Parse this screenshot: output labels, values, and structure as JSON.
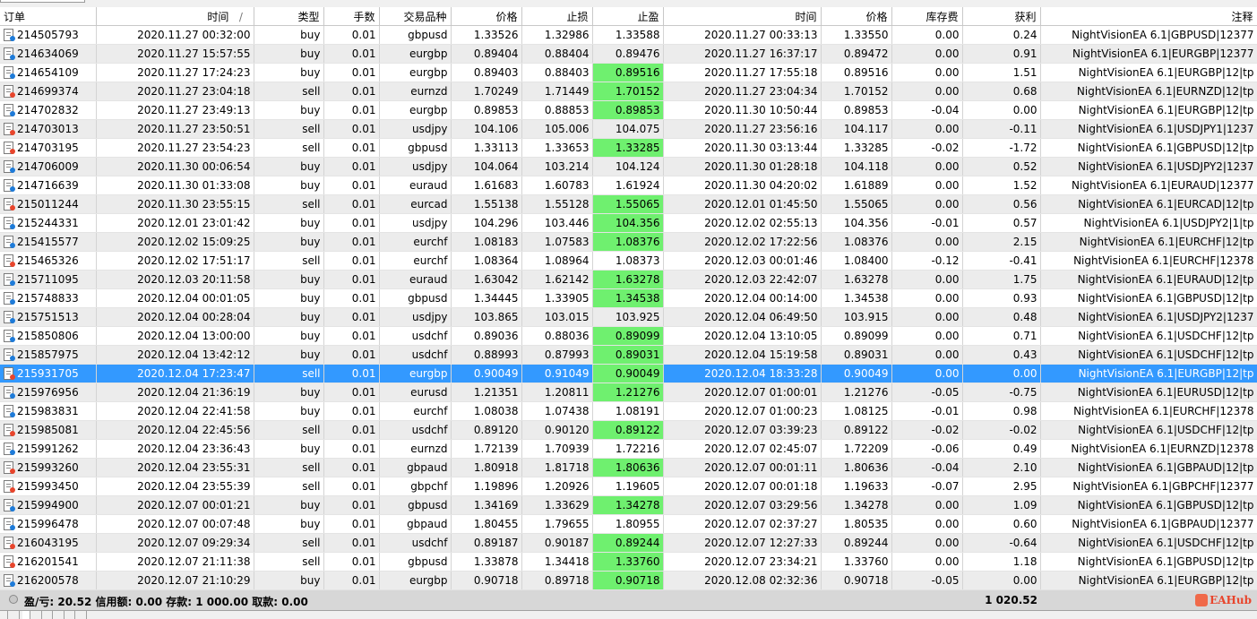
{
  "columns": [
    "订单",
    "时间",
    "类型",
    "手数",
    "交易品种",
    "价格",
    "止损",
    "止盈",
    "时间",
    "价格",
    "库存费",
    "获利",
    "注释"
  ],
  "sort_indicator": "/",
  "rows": [
    {
      "order": "214505793",
      "open_time": "2020.11.27 00:32:00",
      "type": "buy",
      "lots": "0.01",
      "symbol": "gbpusd",
      "price": "1.33526",
      "sl": "1.32986",
      "tp": "1.33588",
      "close_time": "2020.11.27 00:33:13",
      "close_price": "1.33550",
      "swap": "0.00",
      "profit": "0.24",
      "comment": "NightVisionEA 6.1|GBPUSD|12377",
      "tp_hit": false
    },
    {
      "order": "214634069",
      "open_time": "2020.11.27 15:57:55",
      "type": "buy",
      "lots": "0.01",
      "symbol": "eurgbp",
      "price": "0.89404",
      "sl": "0.88404",
      "tp": "0.89476",
      "close_time": "2020.11.27 16:37:17",
      "close_price": "0.89472",
      "swap": "0.00",
      "profit": "0.91",
      "comment": "NightVisionEA 6.1|EURGBP|12377",
      "tp_hit": false
    },
    {
      "order": "214654109",
      "open_time": "2020.11.27 17:24:23",
      "type": "buy",
      "lots": "0.01",
      "symbol": "eurgbp",
      "price": "0.89403",
      "sl": "0.88403",
      "tp": "0.89516",
      "close_time": "2020.11.27 17:55:18",
      "close_price": "0.89516",
      "swap": "0.00",
      "profit": "1.51",
      "comment": "NightVisionEA 6.1|EURGBP|12|tp",
      "tp_hit": true
    },
    {
      "order": "214699374",
      "open_time": "2020.11.27 23:04:18",
      "type": "sell",
      "lots": "0.01",
      "symbol": "eurnzd",
      "price": "1.70249",
      "sl": "1.71449",
      "tp": "1.70152",
      "close_time": "2020.11.27 23:04:34",
      "close_price": "1.70152",
      "swap": "0.00",
      "profit": "0.68",
      "comment": "NightVisionEA 6.1|EURNZD|12|tp",
      "tp_hit": true
    },
    {
      "order": "214702832",
      "open_time": "2020.11.27 23:49:13",
      "type": "buy",
      "lots": "0.01",
      "symbol": "eurgbp",
      "price": "0.89853",
      "sl": "0.88853",
      "tp": "0.89853",
      "close_time": "2020.11.30 10:50:44",
      "close_price": "0.89853",
      "swap": "-0.04",
      "profit": "0.00",
      "comment": "NightVisionEA 6.1|EURGBP|12|tp",
      "tp_hit": true
    },
    {
      "order": "214703013",
      "open_time": "2020.11.27 23:50:51",
      "type": "sell",
      "lots": "0.01",
      "symbol": "usdjpy",
      "price": "104.106",
      "sl": "105.006",
      "tp": "104.075",
      "close_time": "2020.11.27 23:56:16",
      "close_price": "104.117",
      "swap": "0.00",
      "profit": "-0.11",
      "comment": "NightVisionEA 6.1|USDJPY1|1237",
      "tp_hit": false
    },
    {
      "order": "214703195",
      "open_time": "2020.11.27 23:54:23",
      "type": "sell",
      "lots": "0.01",
      "symbol": "gbpusd",
      "price": "1.33113",
      "sl": "1.33653",
      "tp": "1.33285",
      "close_time": "2020.11.30 03:13:44",
      "close_price": "1.33285",
      "swap": "-0.02",
      "profit": "-1.72",
      "comment": "NightVisionEA 6.1|GBPUSD|12|tp",
      "tp_hit": true
    },
    {
      "order": "214706009",
      "open_time": "2020.11.30 00:06:54",
      "type": "buy",
      "lots": "0.01",
      "symbol": "usdjpy",
      "price": "104.064",
      "sl": "103.214",
      "tp": "104.124",
      "close_time": "2020.11.30 01:28:18",
      "close_price": "104.118",
      "swap": "0.00",
      "profit": "0.52",
      "comment": "NightVisionEA 6.1|USDJPY2|1237",
      "tp_hit": false
    },
    {
      "order": "214716639",
      "open_time": "2020.11.30 01:33:08",
      "type": "buy",
      "lots": "0.01",
      "symbol": "euraud",
      "price": "1.61683",
      "sl": "1.60783",
      "tp": "1.61924",
      "close_time": "2020.11.30 04:20:02",
      "close_price": "1.61889",
      "swap": "0.00",
      "profit": "1.52",
      "comment": "NightVisionEA 6.1|EURAUD|12377",
      "tp_hit": false
    },
    {
      "order": "215011244",
      "open_time": "2020.11.30 23:55:15",
      "type": "sell",
      "lots": "0.01",
      "symbol": "eurcad",
      "price": "1.55138",
      "sl": "1.55128",
      "tp": "1.55065",
      "close_time": "2020.12.01 01:45:50",
      "close_price": "1.55065",
      "swap": "0.00",
      "profit": "0.56",
      "comment": "NightVisionEA 6.1|EURCAD|12|tp",
      "tp_hit": true
    },
    {
      "order": "215244331",
      "open_time": "2020.12.01 23:01:42",
      "type": "buy",
      "lots": "0.01",
      "symbol": "usdjpy",
      "price": "104.296",
      "sl": "103.446",
      "tp": "104.356",
      "close_time": "2020.12.02 02:55:13",
      "close_price": "104.356",
      "swap": "-0.01",
      "profit": "0.57",
      "comment": "NightVisionEA 6.1|USDJPY2|1|tp",
      "tp_hit": true
    },
    {
      "order": "215415577",
      "open_time": "2020.12.02 15:09:25",
      "type": "buy",
      "lots": "0.01",
      "symbol": "eurchf",
      "price": "1.08183",
      "sl": "1.07583",
      "tp": "1.08376",
      "close_time": "2020.12.02 17:22:56",
      "close_price": "1.08376",
      "swap": "0.00",
      "profit": "2.15",
      "comment": "NightVisionEA 6.1|EURCHF|12|tp",
      "tp_hit": true
    },
    {
      "order": "215465326",
      "open_time": "2020.12.02 17:51:17",
      "type": "sell",
      "lots": "0.01",
      "symbol": "eurchf",
      "price": "1.08364",
      "sl": "1.08964",
      "tp": "1.08373",
      "close_time": "2020.12.03 00:01:46",
      "close_price": "1.08400",
      "swap": "-0.12",
      "profit": "-0.41",
      "comment": "NightVisionEA 6.1|EURCHF|12378",
      "tp_hit": false
    },
    {
      "order": "215711095",
      "open_time": "2020.12.03 20:11:58",
      "type": "buy",
      "lots": "0.01",
      "symbol": "euraud",
      "price": "1.63042",
      "sl": "1.62142",
      "tp": "1.63278",
      "close_time": "2020.12.03 22:42:07",
      "close_price": "1.63278",
      "swap": "0.00",
      "profit": "1.75",
      "comment": "NightVisionEA 6.1|EURAUD|12|tp",
      "tp_hit": true
    },
    {
      "order": "215748833",
      "open_time": "2020.12.04 00:01:05",
      "type": "buy",
      "lots": "0.01",
      "symbol": "gbpusd",
      "price": "1.34445",
      "sl": "1.33905",
      "tp": "1.34538",
      "close_time": "2020.12.04 00:14:00",
      "close_price": "1.34538",
      "swap": "0.00",
      "profit": "0.93",
      "comment": "NightVisionEA 6.1|GBPUSD|12|tp",
      "tp_hit": true
    },
    {
      "order": "215751513",
      "open_time": "2020.12.04 00:28:04",
      "type": "buy",
      "lots": "0.01",
      "symbol": "usdjpy",
      "price": "103.865",
      "sl": "103.015",
      "tp": "103.925",
      "close_time": "2020.12.04 06:49:50",
      "close_price": "103.915",
      "swap": "0.00",
      "profit": "0.48",
      "comment": "NightVisionEA 6.1|USDJPY2|1237",
      "tp_hit": false
    },
    {
      "order": "215850806",
      "open_time": "2020.12.04 13:00:00",
      "type": "buy",
      "lots": "0.01",
      "symbol": "usdchf",
      "price": "0.89036",
      "sl": "0.88036",
      "tp": "0.89099",
      "close_time": "2020.12.04 13:10:05",
      "close_price": "0.89099",
      "swap": "0.00",
      "profit": "0.71",
      "comment": "NightVisionEA 6.1|USDCHF|12|tp",
      "tp_hit": true
    },
    {
      "order": "215857975",
      "open_time": "2020.12.04 13:42:12",
      "type": "buy",
      "lots": "0.01",
      "symbol": "usdchf",
      "price": "0.88993",
      "sl": "0.87993",
      "tp": "0.89031",
      "close_time": "2020.12.04 15:19:58",
      "close_price": "0.89031",
      "swap": "0.00",
      "profit": "0.43",
      "comment": "NightVisionEA 6.1|USDCHF|12|tp",
      "tp_hit": true
    },
    {
      "order": "215931705",
      "open_time": "2020.12.04 17:23:47",
      "type": "sell",
      "lots": "0.01",
      "symbol": "eurgbp",
      "price": "0.90049",
      "sl": "0.91049",
      "tp": "0.90049",
      "close_time": "2020.12.04 18:33:28",
      "close_price": "0.90049",
      "swap": "0.00",
      "profit": "0.00",
      "comment": "NightVisionEA 6.1|EURGBP|12|tp",
      "tp_hit": true,
      "selected": true
    },
    {
      "order": "215976956",
      "open_time": "2020.12.04 21:36:19",
      "type": "buy",
      "lots": "0.01",
      "symbol": "eurusd",
      "price": "1.21351",
      "sl": "1.20811",
      "tp": "1.21276",
      "close_time": "2020.12.07 01:00:01",
      "close_price": "1.21276",
      "swap": "-0.05",
      "profit": "-0.75",
      "comment": "NightVisionEA 6.1|EURUSD|12|tp",
      "tp_hit": true
    },
    {
      "order": "215983831",
      "open_time": "2020.12.04 22:41:58",
      "type": "buy",
      "lots": "0.01",
      "symbol": "eurchf",
      "price": "1.08038",
      "sl": "1.07438",
      "tp": "1.08191",
      "close_time": "2020.12.07 01:00:23",
      "close_price": "1.08125",
      "swap": "-0.01",
      "profit": "0.98",
      "comment": "NightVisionEA 6.1|EURCHF|12378",
      "tp_hit": false
    },
    {
      "order": "215985081",
      "open_time": "2020.12.04 22:45:56",
      "type": "sell",
      "lots": "0.01",
      "symbol": "usdchf",
      "price": "0.89120",
      "sl": "0.90120",
      "tp": "0.89122",
      "close_time": "2020.12.07 03:39:23",
      "close_price": "0.89122",
      "swap": "-0.02",
      "profit": "-0.02",
      "comment": "NightVisionEA 6.1|USDCHF|12|tp",
      "tp_hit": true
    },
    {
      "order": "215991262",
      "open_time": "2020.12.04 23:36:43",
      "type": "buy",
      "lots": "0.01",
      "symbol": "eurnzd",
      "price": "1.72139",
      "sl": "1.70939",
      "tp": "1.72216",
      "close_time": "2020.12.07 02:45:07",
      "close_price": "1.72209",
      "swap": "-0.06",
      "profit": "0.49",
      "comment": "NightVisionEA 6.1|EURNZD|12378",
      "tp_hit": false
    },
    {
      "order": "215993260",
      "open_time": "2020.12.04 23:55:31",
      "type": "sell",
      "lots": "0.01",
      "symbol": "gbpaud",
      "price": "1.80918",
      "sl": "1.81718",
      "tp": "1.80636",
      "close_time": "2020.12.07 00:01:11",
      "close_price": "1.80636",
      "swap": "-0.04",
      "profit": "2.10",
      "comment": "NightVisionEA 6.1|GBPAUD|12|tp",
      "tp_hit": true
    },
    {
      "order": "215993450",
      "open_time": "2020.12.04 23:55:39",
      "type": "sell",
      "lots": "0.01",
      "symbol": "gbpchf",
      "price": "1.19896",
      "sl": "1.20926",
      "tp": "1.19605",
      "close_time": "2020.12.07 00:01:18",
      "close_price": "1.19633",
      "swap": "-0.07",
      "profit": "2.95",
      "comment": "NightVisionEA 6.1|GBPCHF|12377",
      "tp_hit": false
    },
    {
      "order": "215994900",
      "open_time": "2020.12.07 00:01:21",
      "type": "buy",
      "lots": "0.01",
      "symbol": "gbpusd",
      "price": "1.34169",
      "sl": "1.33629",
      "tp": "1.34278",
      "close_time": "2020.12.07 03:29:56",
      "close_price": "1.34278",
      "swap": "0.00",
      "profit": "1.09",
      "comment": "NightVisionEA 6.1|GBPUSD|12|tp",
      "tp_hit": true
    },
    {
      "order": "215996478",
      "open_time": "2020.12.07 00:07:48",
      "type": "buy",
      "lots": "0.01",
      "symbol": "gbpaud",
      "price": "1.80455",
      "sl": "1.79655",
      "tp": "1.80955",
      "close_time": "2020.12.07 02:37:27",
      "close_price": "1.80535",
      "swap": "0.00",
      "profit": "0.60",
      "comment": "NightVisionEA 6.1|GBPAUD|12377",
      "tp_hit": false
    },
    {
      "order": "216043195",
      "open_time": "2020.12.07 09:29:34",
      "type": "sell",
      "lots": "0.01",
      "symbol": "usdchf",
      "price": "0.89187",
      "sl": "0.90187",
      "tp": "0.89244",
      "close_time": "2020.12.07 12:27:33",
      "close_price": "0.89244",
      "swap": "0.00",
      "profit": "-0.64",
      "comment": "NightVisionEA 6.1|USDCHF|12|tp",
      "tp_hit": true
    },
    {
      "order": "216201541",
      "open_time": "2020.12.07 21:11:38",
      "type": "sell",
      "lots": "0.01",
      "symbol": "gbpusd",
      "price": "1.33878",
      "sl": "1.34418",
      "tp": "1.33760",
      "close_time": "2020.12.07 23:34:21",
      "close_price": "1.33760",
      "swap": "0.00",
      "profit": "1.18",
      "comment": "NightVisionEA 6.1|GBPUSD|12|tp",
      "tp_hit": true
    },
    {
      "order": "216200578",
      "open_time": "2020.12.07 21:10:29",
      "type": "buy",
      "lots": "0.01",
      "symbol": "eurgbp",
      "price": "0.90718",
      "sl": "0.89718",
      "tp": "0.90718",
      "close_time": "2020.12.08 02:32:36",
      "close_price": "0.90718",
      "swap": "-0.05",
      "profit": "0.00",
      "comment": "NightVisionEA 6.1|EURGBP|12|tp",
      "tp_hit": true
    }
  ],
  "footer": {
    "summary": "盈/亏: 20.52  信用额: 0.00  存款: 1 000.00  取款: 0.00",
    "total": "1 020.52"
  },
  "watermark": "EAHub",
  "colors": {
    "selected_row": "#3399ff",
    "tp_highlight": "#6ff06f",
    "buy_icon": "#1e7bd9",
    "sell_icon": "#e8452c"
  },
  "icons": {
    "buy": "ticket-buy-icon",
    "sell": "ticket-sell-icon"
  }
}
